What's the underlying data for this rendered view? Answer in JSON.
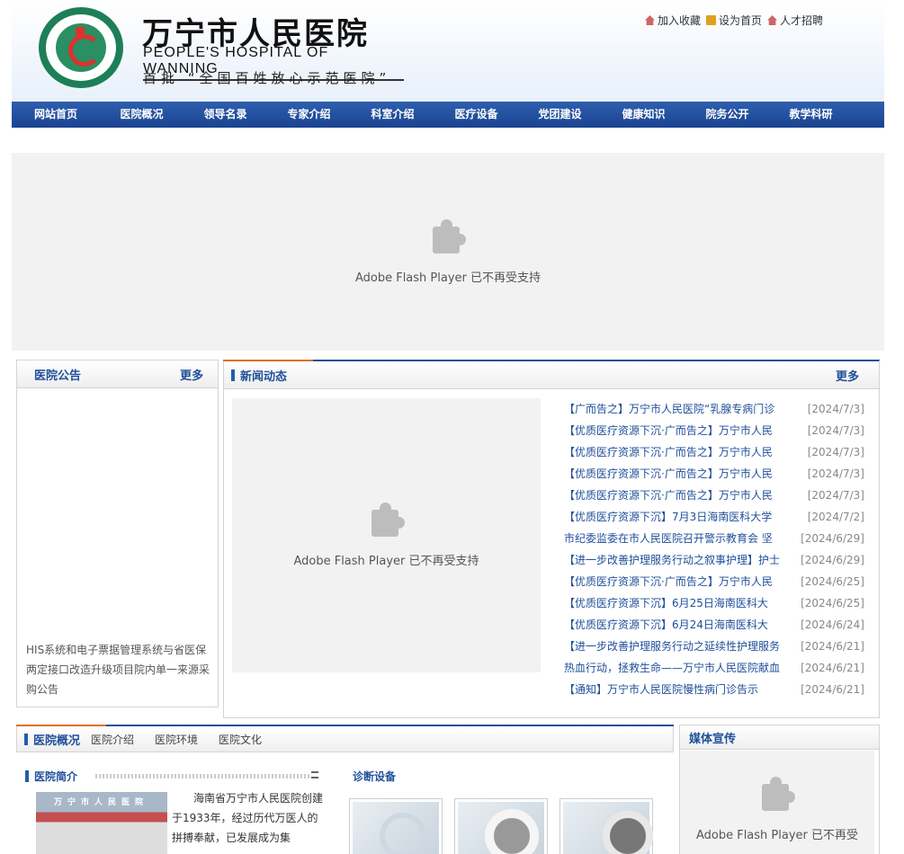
{
  "header": {
    "name_cn": "万宁市人民医院",
    "name_en": "PEOPLE'S HOSPITAL OF WANNING",
    "motto": "首批 “全国百姓放心示范医院”",
    "top_links": [
      "加入收藏",
      "设为首页",
      "人才招聘"
    ]
  },
  "nav": [
    "网站首页",
    "医院概况",
    "领导名录",
    "专家介绍",
    "科室介绍",
    "医疗设备",
    "党团建设",
    "健康知识",
    "院务公开",
    "教学科研"
  ],
  "flash_message": "Adobe Flash Player 已不再受支持",
  "notice": {
    "title": "医院公告",
    "more": "更多",
    "text": "HIS系统和电子票据管理系统与省医保两定接口改造升级项目院内单一来源采购公告"
  },
  "news": {
    "title": "新闻动态",
    "more": "更多",
    "items": [
      {
        "title": "【广而告之】万宁市人民医院“乳腺专病门诊",
        "date": "[2024/7/3]"
      },
      {
        "title": "【优质医疗资源下沉·广而告之】万宁市人民",
        "date": "[2024/7/3]"
      },
      {
        "title": "【优质医疗资源下沉·广而告之】万宁市人民",
        "date": "[2024/7/3]"
      },
      {
        "title": "【优质医疗资源下沉·广而告之】万宁市人民",
        "date": "[2024/7/3]"
      },
      {
        "title": "【优质医疗资源下沉·广而告之】万宁市人民",
        "date": "[2024/7/3]"
      },
      {
        "title": "【优质医疗资源下沉】7月3日海南医科大学",
        "date": "[2024/7/2]"
      },
      {
        "title": "市纪委监委在市人民医院召开警示教育会 坚",
        "date": "[2024/6/29]"
      },
      {
        "title": "【进一步改善护理服务行动之叙事护理】护士",
        "date": "[2024/6/29]"
      },
      {
        "title": "【优质医疗资源下沉·广而告之】万宁市人民",
        "date": "[2024/6/25]"
      },
      {
        "title": "【优质医疗资源下沉】6月25日海南医科大",
        "date": "[2024/6/25]"
      },
      {
        "title": "【优质医疗资源下沉】6月24日海南医科大",
        "date": "[2024/6/24]"
      },
      {
        "title": "【进一步改善护理服务行动之延续性护理服务",
        "date": "[2024/6/21]"
      },
      {
        "title": "热血行动，拯救生命——万宁市人民医院献血",
        "date": "[2024/6/21]"
      },
      {
        "title": "【通知】万宁市人民医院慢性病门诊告示",
        "date": "[2024/6/21]"
      }
    ]
  },
  "overview": {
    "title": "医院概况",
    "tabs": [
      "医院介绍",
      "医院环境",
      "医院文化"
    ],
    "intro_title": "医院简介",
    "photo_sign": "万宁市人民医院",
    "intro_text": "海南省万宁市人民医院创建于1933年，经过历代万医人的拼搏奉献，已发展成为集",
    "equip_title": "诊断设备"
  },
  "media": {
    "title": "媒体宣传",
    "flash_message": "Adobe Flash Player 已不再受"
  },
  "colors": {
    "nav": "#1f4f9a",
    "accent": "#e07020",
    "link": "#1f4f9a"
  }
}
